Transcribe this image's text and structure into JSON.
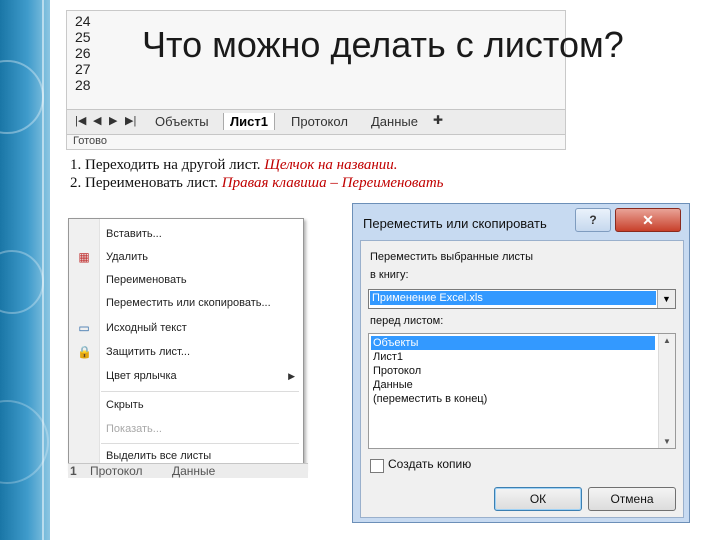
{
  "slide": {
    "title": "Что можно делать с листом?",
    "instructions": [
      {
        "num": "1.",
        "text": "Переходить на другой лист.",
        "hint": "Щелчок на названии."
      },
      {
        "num": "2.",
        "text": "Переименовать лист.",
        "hint": "Правая клавиша – Переименовать"
      }
    ]
  },
  "excel_top": {
    "row_numbers": [
      "24",
      "25",
      "26",
      "27",
      "28"
    ],
    "tabs": [
      "Объекты",
      "Лист1",
      "Протокол",
      "Данные"
    ],
    "active_tab": "Лист1",
    "status": "Готово"
  },
  "context_menu": {
    "items": [
      {
        "label": "Вставить...",
        "icon": "none",
        "disabled": false
      },
      {
        "label": "Удалить",
        "icon": "delete-sheet-icon",
        "disabled": false
      },
      {
        "label": "Переименовать",
        "icon": "none",
        "disabled": false
      },
      {
        "label": "Переместить или скопировать...",
        "icon": "none",
        "disabled": false
      },
      {
        "label": "Исходный текст",
        "icon": "view-code-icon",
        "disabled": false
      },
      {
        "label": "Защитить лист...",
        "icon": "protect-sheet-icon",
        "disabled": false
      },
      {
        "label": "Цвет ярлычка",
        "icon": "none",
        "disabled": false,
        "submenu": true
      },
      {
        "label": "Скрыть",
        "icon": "none",
        "disabled": false
      },
      {
        "label": "Показать...",
        "icon": "none",
        "disabled": true
      },
      {
        "label": "Выделить все листы",
        "icon": "none",
        "disabled": false
      }
    ],
    "under_tabs": [
      "1",
      "Протокол",
      "Данные"
    ]
  },
  "dialog": {
    "title": "Переместить или скопировать",
    "help_label": "?",
    "close_label": "✕",
    "move_label": "Переместить выбранные листы",
    "book_label": "в книгу:",
    "book_value": "Применение Excel.xls",
    "before_label": "перед листом:",
    "sheets": [
      "Объекты",
      "Лист1",
      "Протокол",
      "Данные",
      "(переместить в конец)"
    ],
    "selected_sheet_index": 0,
    "copy_label": "Создать копию",
    "copy_checked": false,
    "ok_label": "ОК",
    "cancel_label": "Отмена"
  }
}
